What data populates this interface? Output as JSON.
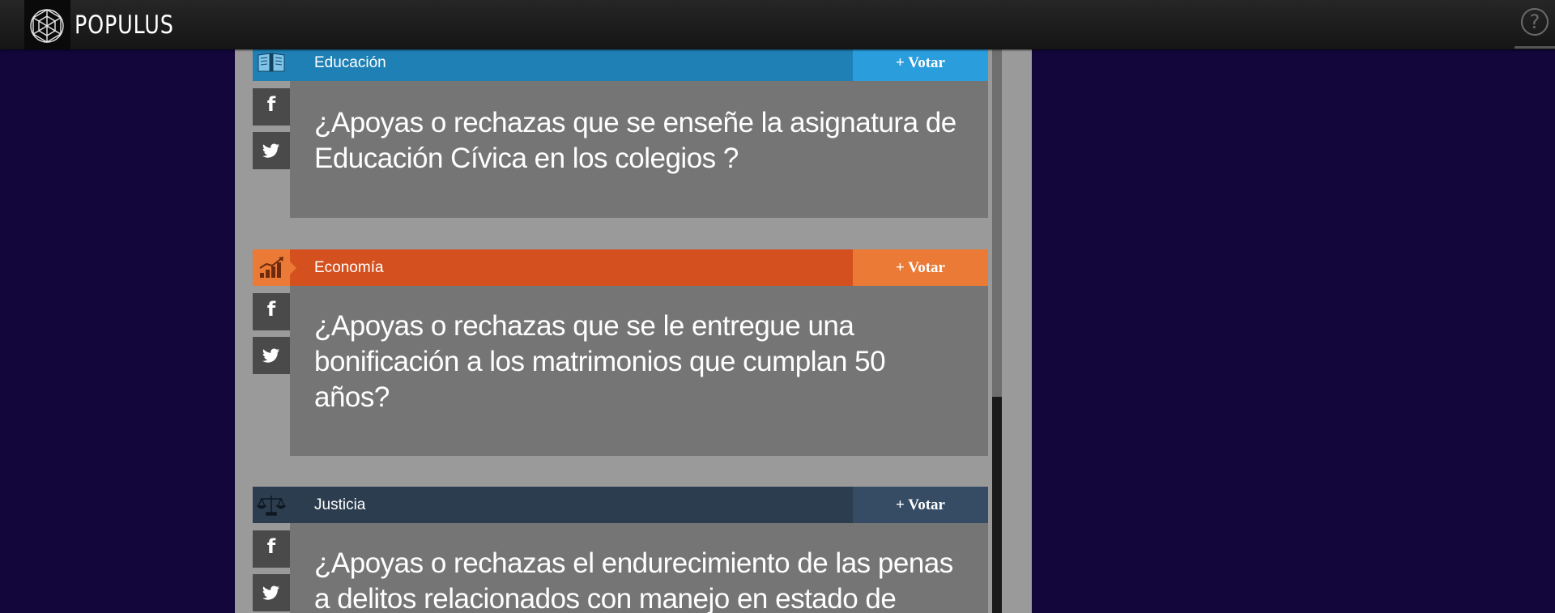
{
  "header": {
    "brand": "POPULUS",
    "help_glyph": "?",
    "logo_icon": "geodesic-sphere-icon",
    "help_icon": "help-circle-icon"
  },
  "colors": {
    "background": "#12063a",
    "panel": "#9a9a9a",
    "question_box": "#757575",
    "social_button": "#4a4a4a"
  },
  "cards": [
    {
      "category": "Educación",
      "category_icon": "book-icon",
      "vote_label": "+ Votar",
      "question": "¿Apoyas o rechazas que se enseñe la asignatura de Educación Cívica en los colegios ?",
      "bar_color": "#1f80b5",
      "icon_color": "#1f80b5",
      "vote_color": "#2a9ddd",
      "facebook_glyph": "f",
      "twitter_icon": "twitter-bird-icon"
    },
    {
      "category": "Economía",
      "category_icon": "bar-chart-icon",
      "vote_label": "+ Votar",
      "question": "¿Apoyas o rechazas que se le entregue una bonificación a los matrimonios que cumplan 50 años?",
      "bar_color": "#d4511f",
      "icon_color": "#ea7a35",
      "vote_color": "#ea7a35",
      "facebook_glyph": "f",
      "twitter_icon": "twitter-bird-icon"
    },
    {
      "category": "Justicia",
      "category_icon": "scales-icon",
      "vote_label": "+ Votar",
      "question": "¿Apoyas o rechazas el endurecimiento de las penas a delitos relacionados con manejo en estado de",
      "bar_color": "#2b3d4f",
      "icon_color": "#2b3d4f",
      "vote_color": "#354c64",
      "facebook_glyph": "f",
      "twitter_icon": "twitter-bird-icon"
    }
  ]
}
